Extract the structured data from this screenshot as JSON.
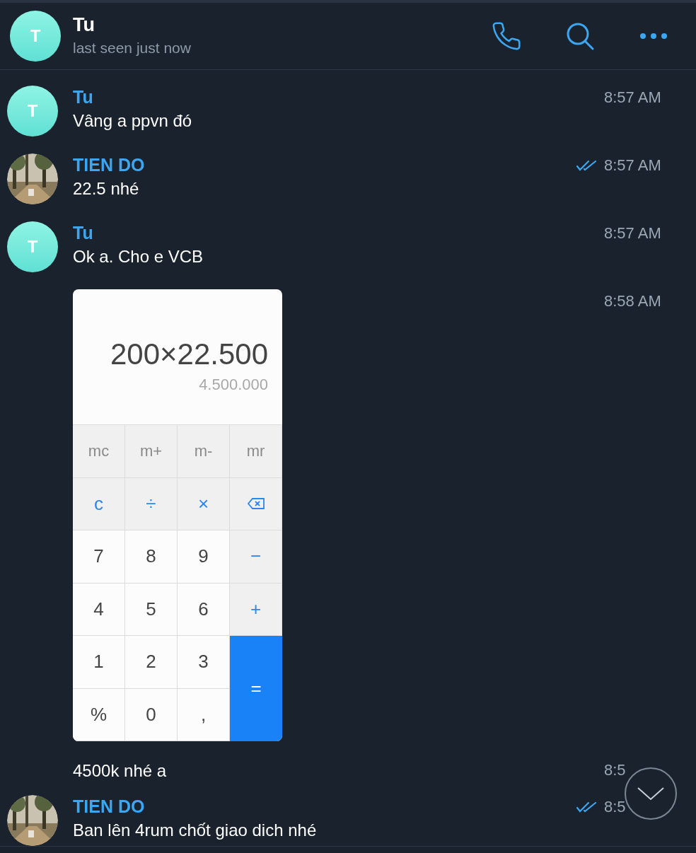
{
  "header": {
    "avatar_letter": "T",
    "name": "Tu",
    "status": "last seen just now"
  },
  "messages": [
    {
      "kind": "text",
      "avatar": {
        "kind": "letter",
        "letter": "T"
      },
      "sender": "Tu",
      "text": "Vâng a ppvn đó",
      "time": "8:57 AM",
      "read": false
    },
    {
      "kind": "text",
      "sender": "TIEN DO",
      "text": "22.5 nhé",
      "time": "8:57 AM",
      "read": true
    },
    {
      "kind": "text",
      "avatar": {
        "kind": "letter",
        "letter": "T"
      },
      "sender": "Tu",
      "text": "Ok a. Cho e VCB",
      "time": "8:57 AM",
      "read": false
    },
    {
      "kind": "calculator",
      "time": "8:58 AM",
      "read": false,
      "calculator": {
        "expression": "200×22.500",
        "result": "4.500.000",
        "keys": [
          {
            "label": "mc",
            "kind": "memory"
          },
          {
            "label": "m+",
            "kind": "memory"
          },
          {
            "label": "m-",
            "kind": "memory"
          },
          {
            "label": "mr",
            "kind": "memory"
          },
          {
            "label": "c",
            "kind": "operator"
          },
          {
            "label": "÷",
            "kind": "operator"
          },
          {
            "label": "×",
            "kind": "operator"
          },
          {
            "kind": "backspace"
          },
          {
            "label": "7",
            "kind": "digit"
          },
          {
            "label": "8",
            "kind": "digit"
          },
          {
            "label": "9",
            "kind": "digit"
          },
          {
            "label": "−",
            "kind": "side"
          },
          {
            "label": "4",
            "kind": "digit"
          },
          {
            "label": "5",
            "kind": "digit"
          },
          {
            "label": "6",
            "kind": "digit"
          },
          {
            "label": "+",
            "kind": "side"
          },
          {
            "label": "1",
            "kind": "digit"
          },
          {
            "label": "2",
            "kind": "digit"
          },
          {
            "label": "3",
            "kind": "digit"
          },
          {
            "label": "=",
            "kind": "equals"
          },
          {
            "label": "%",
            "kind": "digit"
          },
          {
            "label": "0",
            "kind": "digit"
          },
          {
            "label": ",",
            "kind": "digit"
          }
        ]
      }
    },
    {
      "kind": "text",
      "text": "4500k nhé a",
      "time": "8:5",
      "read": false
    },
    {
      "kind": "text",
      "sender": "TIEN DO",
      "text": "Ban lên 4rum chốt giao dich nhé",
      "time": "8:5",
      "read": true
    }
  ]
}
